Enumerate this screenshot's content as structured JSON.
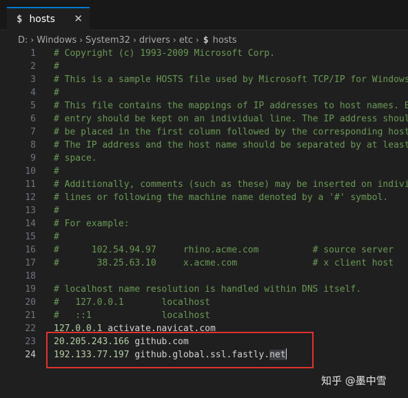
{
  "tab": {
    "icon": "dollar-icon",
    "icon_glyph": "$",
    "title": "hosts",
    "close_glyph": "✕"
  },
  "breadcrumb": {
    "parts": [
      "D:",
      "Windows",
      "System32",
      "drivers",
      "etc"
    ],
    "file_icon_glyph": "$",
    "file": "hosts",
    "separator": "›"
  },
  "lines": [
    {
      "n": "1",
      "kind": "comment",
      "text": "# Copyright (c) 1993-2009 Microsoft Corp."
    },
    {
      "n": "2",
      "kind": "comment",
      "text": "#"
    },
    {
      "n": "3",
      "kind": "comment",
      "text": "# This is a sample HOSTS file used by Microsoft TCP/IP for Windows."
    },
    {
      "n": "4",
      "kind": "comment",
      "text": "#"
    },
    {
      "n": "5",
      "kind": "comment",
      "text": "# This file contains the mappings of IP addresses to host names. Ea"
    },
    {
      "n": "6",
      "kind": "comment",
      "text": "# entry should be kept on an individual line. The IP address should"
    },
    {
      "n": "7",
      "kind": "comment",
      "text": "# be placed in the first column followed by the corresponding host"
    },
    {
      "n": "8",
      "kind": "comment",
      "text": "# The IP address and the host name should be separated by at least"
    },
    {
      "n": "9",
      "kind": "comment",
      "text": "# space."
    },
    {
      "n": "10",
      "kind": "comment",
      "text": "#"
    },
    {
      "n": "11",
      "kind": "comment",
      "text": "# Additionally, comments (such as these) may be inserted on individ"
    },
    {
      "n": "12",
      "kind": "comment",
      "text": "# lines or following the machine name denoted by a '#' symbol."
    },
    {
      "n": "13",
      "kind": "comment",
      "text": "#"
    },
    {
      "n": "14",
      "kind": "comment",
      "text": "# For example:"
    },
    {
      "n": "15",
      "kind": "comment",
      "text": "#"
    },
    {
      "n": "16",
      "kind": "comment",
      "text": "#      102.54.94.97     rhino.acme.com          # source server"
    },
    {
      "n": "17",
      "kind": "comment",
      "text": "#       38.25.63.10     x.acme.com              # x client host"
    },
    {
      "n": "18",
      "kind": "blank",
      "text": ""
    },
    {
      "n": "19",
      "kind": "comment",
      "text": "# localhost name resolution is handled within DNS itself."
    },
    {
      "n": "20",
      "kind": "comment",
      "text": "#   127.0.0.1       localhost"
    },
    {
      "n": "21",
      "kind": "comment",
      "text": "#   ::1             localhost"
    },
    {
      "n": "22",
      "kind": "entry",
      "ip": "127.0.0.1",
      "host": "activate.navicat.com"
    },
    {
      "n": "23",
      "kind": "entry",
      "ip": "20.205.243.166",
      "host": "github.com"
    },
    {
      "n": "24",
      "kind": "entry",
      "ip": "192.133.77.197",
      "host_pre": "github.global.ssl.fastly.",
      "host_hl": "net",
      "active": true
    }
  ],
  "watermark": "知乎 @墨中雪",
  "colors": {
    "accent": "#0078d4",
    "comment": "#6a9955",
    "number": "#b5cea8",
    "highlight_box": "#e0322f"
  }
}
